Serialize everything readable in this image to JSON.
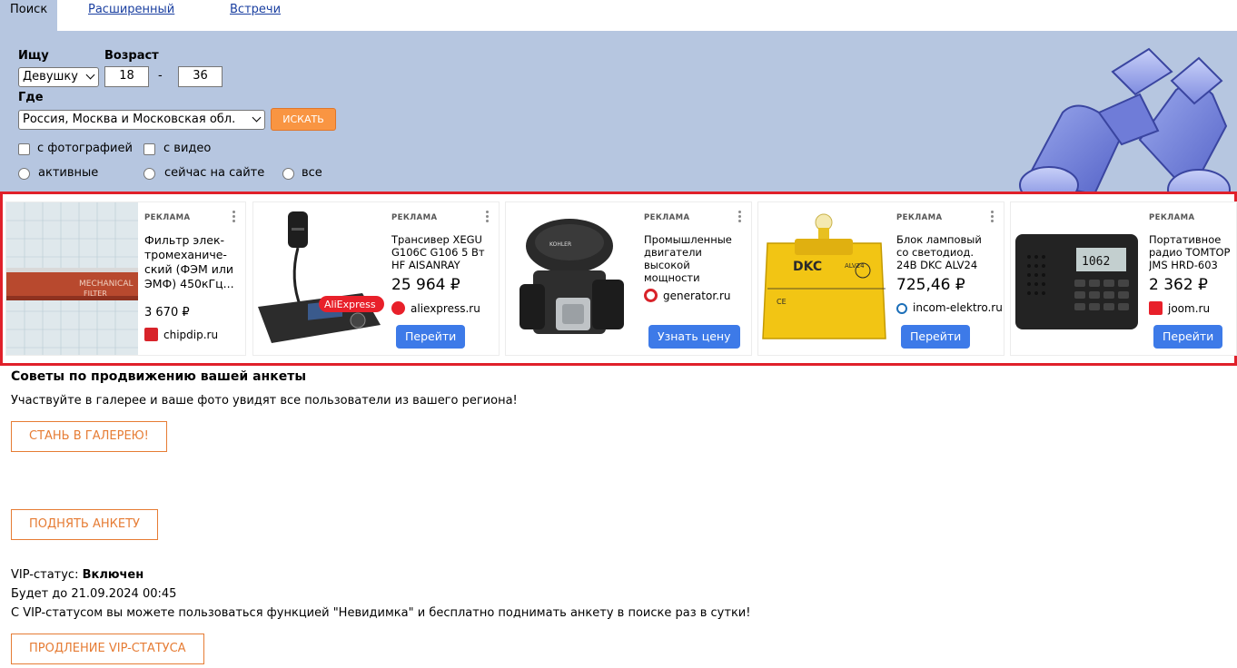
{
  "tabs": {
    "search": "Поиск",
    "extended": "Расширенный",
    "meetings": "Встречи"
  },
  "search": {
    "looking_for_label": "Ищу",
    "looking_for_value": "Девушку",
    "age_label": "Возраст",
    "age_from": "18",
    "age_dash": "-",
    "age_to": "36",
    "where_label": "Где",
    "where_value": "Россия, Москва и Московская обл.",
    "search_button": "ИСКАТЬ",
    "with_photo": "с фотографией",
    "with_video": "с видео",
    "radio_active": "активные",
    "radio_online": "сейчас на сайте",
    "radio_all": "все"
  },
  "ads": [
    {
      "tag": "РЕКЛАМА",
      "title": "Фильтр элек-тромеханиче-ский (ФЭМ или ЭМФ) 450кГц...",
      "price": "3 670 ₽",
      "domain": "chipdip.ru",
      "favicon_color": "#d8232a",
      "button": ""
    },
    {
      "tag": "РЕКЛАМА",
      "title": "Трансивер XEGU G106C G106 5 Вт HF AISANRAY",
      "price": "25 964 ₽",
      "domain": "aliexpress.ru",
      "favicon_color": "#e8202a",
      "button": "Перейти",
      "badge": "AliExpress"
    },
    {
      "tag": "РЕКЛАМА",
      "title": "Промышленные двигатели высокой мощности",
      "price": "",
      "domain": "generator.ru",
      "favicon_color": "#d8232a",
      "button": "Узнать цену"
    },
    {
      "tag": "РЕКЛАМА",
      "title": "Блок ламповый со светодиод. 24В DKC ALV24",
      "price": "725,46 ₽",
      "domain": "incom-elektro.ru",
      "favicon_color": "#1c6fb8",
      "button": "Перейти"
    },
    {
      "tag": "РЕКЛАМА",
      "title": "Портативное радио TOMTOP JMS HRD-603",
      "price": "2 362 ₽",
      "domain": "joom.ru",
      "favicon_color": "#e8202a",
      "button": "Перейти",
      "radio_display": "1062"
    }
  ],
  "tips": {
    "title": "Советы по продвижению вашей анкеты",
    "gallery_text": "Участвуйте в галерее и ваше фото увидят все пользователи из вашего региона!",
    "gallery_button": "СТАНЬ В ГАЛЕРЕЮ!",
    "raise_button": "ПОДНЯТЬ АНКЕТУ",
    "vip_label": "VIP-статус:",
    "vip_status": "Включен",
    "vip_until": "Будет до 21.09.2024 00:45",
    "vip_info": "С VIP-статусом вы можете пользоваться функцией \"Невидимка\" и бесплатно поднимать анкету в поиске раз в сутки!",
    "vip_button": "ПРОДЛЕНИЕ VIP-СТАТУСА"
  },
  "colors": {
    "panel_bg": "#b6c6e0",
    "accent_orange": "#f99542",
    "ad_border": "#e0202a",
    "ad_button": "#3d7ae8",
    "link": "#1a3fa0"
  }
}
